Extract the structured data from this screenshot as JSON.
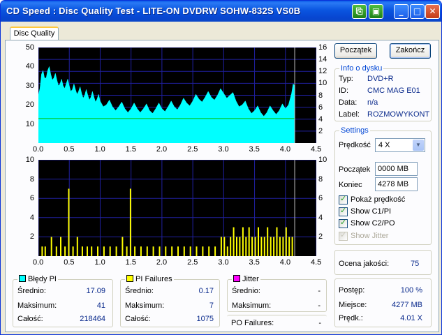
{
  "window": {
    "title": "CD Speed : Disc Quality Test - LITE-ON DVDRW SOHW-832S  VS0B"
  },
  "tabs": [
    {
      "label": "Disc Quality"
    }
  ],
  "buttons": {
    "start": "Początek",
    "stop": "Zakończ"
  },
  "disc_info": {
    "title": "Info o dysku",
    "rows": [
      {
        "label": "Typ:",
        "value": "DVD+R"
      },
      {
        "label": "ID:",
        "value": "CMC MAG E01"
      },
      {
        "label": "Data:",
        "value": "n/a"
      },
      {
        "label": "Label:",
        "value": "ROZMOWYKONT"
      }
    ]
  },
  "settings": {
    "title": "Settings",
    "speed_label": "Prędkość",
    "speed_value": "4 X",
    "start_label": "Początek",
    "start_value": "0000 MB",
    "end_label": "Koniec",
    "end_value": "4278 MB",
    "checkboxes": [
      {
        "label": "Pokaż prędkość",
        "checked": true,
        "disabled": false
      },
      {
        "label": "Show C1/PI",
        "checked": true,
        "disabled": false
      },
      {
        "label": "Show C2/PO",
        "checked": true,
        "disabled": false
      },
      {
        "label": "Show Jitter",
        "checked": true,
        "disabled": true
      }
    ]
  },
  "quality": {
    "label": "Ocena jakości:",
    "value": "75"
  },
  "progress": {
    "rows": [
      {
        "label": "Postęp:",
        "value": "100 %"
      },
      {
        "label": "Miejsce:",
        "value": "4277 MB"
      },
      {
        "label": "Prędk.:",
        "value": "4.01 X"
      }
    ]
  },
  "stats": {
    "pi_errors": {
      "title": "Błędy PI",
      "color": "#00ffff",
      "rows": [
        {
          "label": "Średnio:",
          "value": "17.09"
        },
        {
          "label": "Maksimum:",
          "value": "41"
        },
        {
          "label": "Całość:",
          "value": "218464"
        }
      ]
    },
    "pi_failures": {
      "title": "PI Failures",
      "color": "#ffff00",
      "rows": [
        {
          "label": "Średnio:",
          "value": "0.17"
        },
        {
          "label": "Maksimum:",
          "value": "7"
        },
        {
          "label": "Całość:",
          "value": "1075"
        }
      ]
    },
    "jitter": {
      "title": "Jitter",
      "color": "#ff00ff",
      "rows": [
        {
          "label": "Średnio:",
          "value": "-"
        },
        {
          "label": "Maksimum:",
          "value": "-"
        }
      ]
    },
    "po_failures": {
      "label": "PO Failures:",
      "value": "-"
    }
  },
  "chart_data": [
    {
      "type": "area",
      "name": "pi-errors-chart",
      "xlim": [
        0,
        4.5
      ],
      "ylim": [
        0,
        50
      ],
      "y2lim": [
        0,
        16
      ],
      "x_ticks": [
        "0.0",
        "0.5",
        "1.0",
        "1.5",
        "2.0",
        "2.5",
        "3.0",
        "3.5",
        "4.0",
        "4.5"
      ],
      "y_ticks": [
        "10",
        "20",
        "30",
        "40",
        "50"
      ],
      "y2_ticks": [
        "2",
        "4",
        "6",
        "8",
        "10",
        "12",
        "14",
        "16"
      ],
      "series": [
        {
          "color": "#00ffff",
          "kind": "area",
          "x": [
            0.0,
            0.05,
            0.1,
            0.15,
            0.2,
            0.25,
            0.3,
            0.35,
            0.4,
            0.45,
            0.5,
            0.55,
            0.6,
            0.65,
            0.7,
            0.75,
            0.8,
            0.85,
            0.9,
            0.95,
            1.0,
            1.1,
            1.2,
            1.3,
            1.4,
            1.5,
            1.6,
            1.7,
            1.8,
            1.9,
            2.0,
            2.1,
            2.2,
            2.3,
            2.4,
            2.5,
            2.6,
            2.7,
            2.8,
            2.9,
            3.0,
            3.1,
            3.2,
            3.3,
            3.4,
            3.5,
            3.6,
            3.7,
            3.8,
            3.9,
            4.0,
            4.1,
            4.15
          ],
          "y": [
            25,
            36,
            34,
            38,
            36,
            34,
            33,
            31,
            30,
            31,
            30,
            28,
            28,
            27,
            26,
            25,
            25,
            24,
            24,
            23,
            22,
            20,
            19,
            19,
            18,
            18,
            18,
            18,
            17,
            18,
            18,
            19,
            19,
            20,
            21,
            22,
            23,
            24,
            24,
            25,
            26,
            25,
            22,
            20,
            18,
            17,
            16,
            16,
            17,
            17,
            18,
            26,
            30
          ]
        },
        {
          "color": "#00c000",
          "kind": "line",
          "x": [
            0.0,
            4.15
          ],
          "y": [
            4.1,
            4.1
          ]
        }
      ],
      "cursor_x": 4.15
    },
    {
      "type": "bar",
      "name": "pi-failures-chart",
      "xlim": [
        0,
        4.5
      ],
      "ylim": [
        0,
        10
      ],
      "y2lim": [
        0,
        10
      ],
      "x_ticks": [
        "0.0",
        "0.5",
        "1.0",
        "1.5",
        "2.0",
        "2.5",
        "3.0",
        "3.5",
        "4.0",
        "4.5"
      ],
      "y_ticks": [
        "2",
        "4",
        "6",
        "8",
        "10"
      ],
      "y2_ticks": [
        "2",
        "4",
        "6",
        "8",
        "10"
      ],
      "series": [
        {
          "color": "#ffff00",
          "x": [
            0.05,
            0.1,
            0.2,
            0.28,
            0.35,
            0.42,
            0.48,
            0.55,
            0.62,
            0.7,
            0.78,
            0.85,
            0.95,
            1.05,
            1.15,
            1.25,
            1.35,
            1.42,
            1.48,
            1.55,
            1.65,
            1.75,
            1.85,
            1.95,
            2.05,
            2.15,
            2.25,
            2.35,
            2.45,
            2.55,
            2.65,
            2.75,
            2.85,
            2.95,
            3.0,
            3.05,
            3.1,
            3.15,
            3.2,
            3.25,
            3.3,
            3.35,
            3.4,
            3.45,
            3.5,
            3.55,
            3.6,
            3.65,
            3.7,
            3.75,
            3.8,
            3.85,
            3.9,
            3.95,
            4.0,
            4.05,
            4.1
          ],
          "y": [
            1,
            1,
            2,
            1,
            2,
            1,
            7,
            1,
            2,
            1,
            1,
            1,
            1,
            1,
            1,
            1,
            2,
            1,
            7,
            1,
            1,
            1,
            1,
            1,
            1,
            1,
            1,
            1,
            1,
            1,
            1,
            1,
            1,
            2,
            2,
            1,
            2,
            3,
            2,
            2,
            3,
            2,
            3,
            2,
            2,
            3,
            2,
            2,
            3,
            2,
            2,
            3,
            2,
            2,
            3,
            2,
            2
          ]
        }
      ],
      "cursor_x": 4.15
    }
  ]
}
